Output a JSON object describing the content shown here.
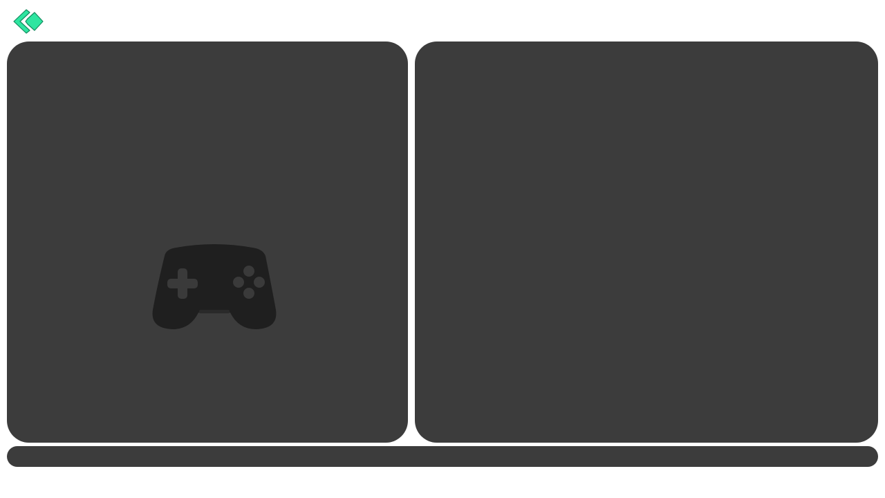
{
  "colors": {
    "page_background": "#ffffff",
    "panel": "#3c3c3c",
    "controller_body": "#1f1f1f",
    "controller_detail": "#3a3a3a",
    "accent": "#2ee5a0",
    "accent_dark": "#138a5e"
  },
  "icons": {
    "back": "double-chevron-left-icon",
    "placeholder": "gamepad-icon"
  }
}
